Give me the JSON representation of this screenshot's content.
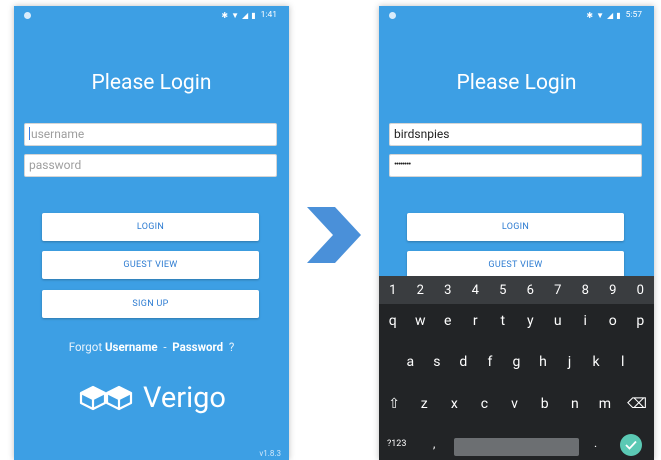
{
  "left_screen": {
    "status_time": "1:41",
    "title": "Please Login",
    "username_placeholder": "username",
    "password_placeholder": "password",
    "login_label": "LOGIN",
    "guest_label": "GUEST VIEW",
    "signup_label": "SIGN UP",
    "forgot_prefix": "Forgot",
    "forgot_username": "Username",
    "forgot_sep": "-",
    "forgot_password": "Password",
    "forgot_suffix": "?",
    "brand_name": "Verigo",
    "version": "v1.8.3"
  },
  "right_screen": {
    "status_time": "5:57",
    "title": "Please Login",
    "username_value": "birdsnpies",
    "password_value": "••••••••",
    "login_label": "LOGIN",
    "guest_label": "GUEST VIEW"
  },
  "keyboard": {
    "number_row": [
      "1",
      "2",
      "3",
      "4",
      "5",
      "6",
      "7",
      "8",
      "9",
      "0"
    ],
    "row1": [
      "q",
      "w",
      "e",
      "r",
      "t",
      "y",
      "u",
      "i",
      "o",
      "p"
    ],
    "row2": [
      "a",
      "s",
      "d",
      "f",
      "g",
      "h",
      "j",
      "k",
      "l"
    ],
    "row3": [
      "⇧",
      "z",
      "x",
      "c",
      "v",
      "b",
      "n",
      "m",
      "⌫"
    ],
    "symbols_key": "?123",
    "comma_key": ",",
    "period_key": "."
  },
  "colors": {
    "screen_bg": "#3d9fe4",
    "button_text": "#2c7bd1",
    "arrow": "#4a90d9",
    "keyboard_bg": "#222426",
    "enter_key": "#5bc9b4"
  },
  "icons": [
    "bluetooth-icon",
    "wifi-icon",
    "signal-icon",
    "battery-icon",
    "verigo-logo-icon",
    "next-arrow-icon",
    "shift-icon",
    "backspace-icon",
    "check-icon"
  ]
}
